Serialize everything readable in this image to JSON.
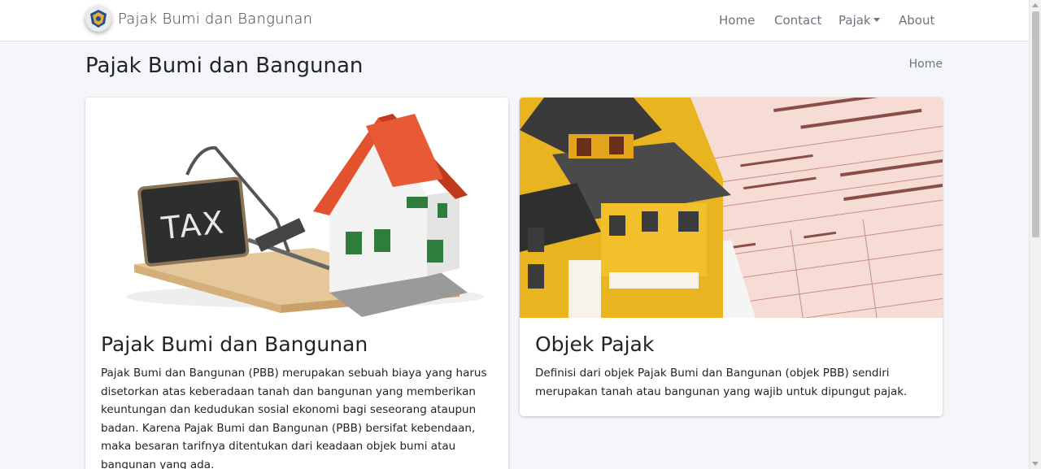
{
  "brand": {
    "name": "Pajak Bumi dan Bangunan",
    "logo_icon": "kemenkeu-logo-icon"
  },
  "nav": {
    "home": "Home",
    "contact": "Contact",
    "pajak": "Pajak",
    "about": "About"
  },
  "header": {
    "title": "Pajak Bumi dan Bangunan",
    "breadcrumb": "Home"
  },
  "cards": [
    {
      "title": "Pajak Bumi dan Bangunan",
      "text": "Pajak Bumi dan Bangunan (PBB) merupakan sebuah biaya yang harus disetorkan atas keberadaan tanah dan bangunan yang memberikan keuntungan dan kedudukan sosial ekonomi bagi seseorang ataupun badan. Karena Pajak Bumi dan Bangunan (PBB) bersifat kebendaan, maka besaran tarifnya ditentukan dari keadaan objek bumi atau bangunan yang ada.",
      "image_label": "TAX"
    },
    {
      "title": "Objek Pajak",
      "text": "Definisi dari objek Pajak Bumi dan Bangunan (objek PBB) sendiri merupakan tanah atau bangunan yang wajib untuk dipungut pajak."
    }
  ]
}
